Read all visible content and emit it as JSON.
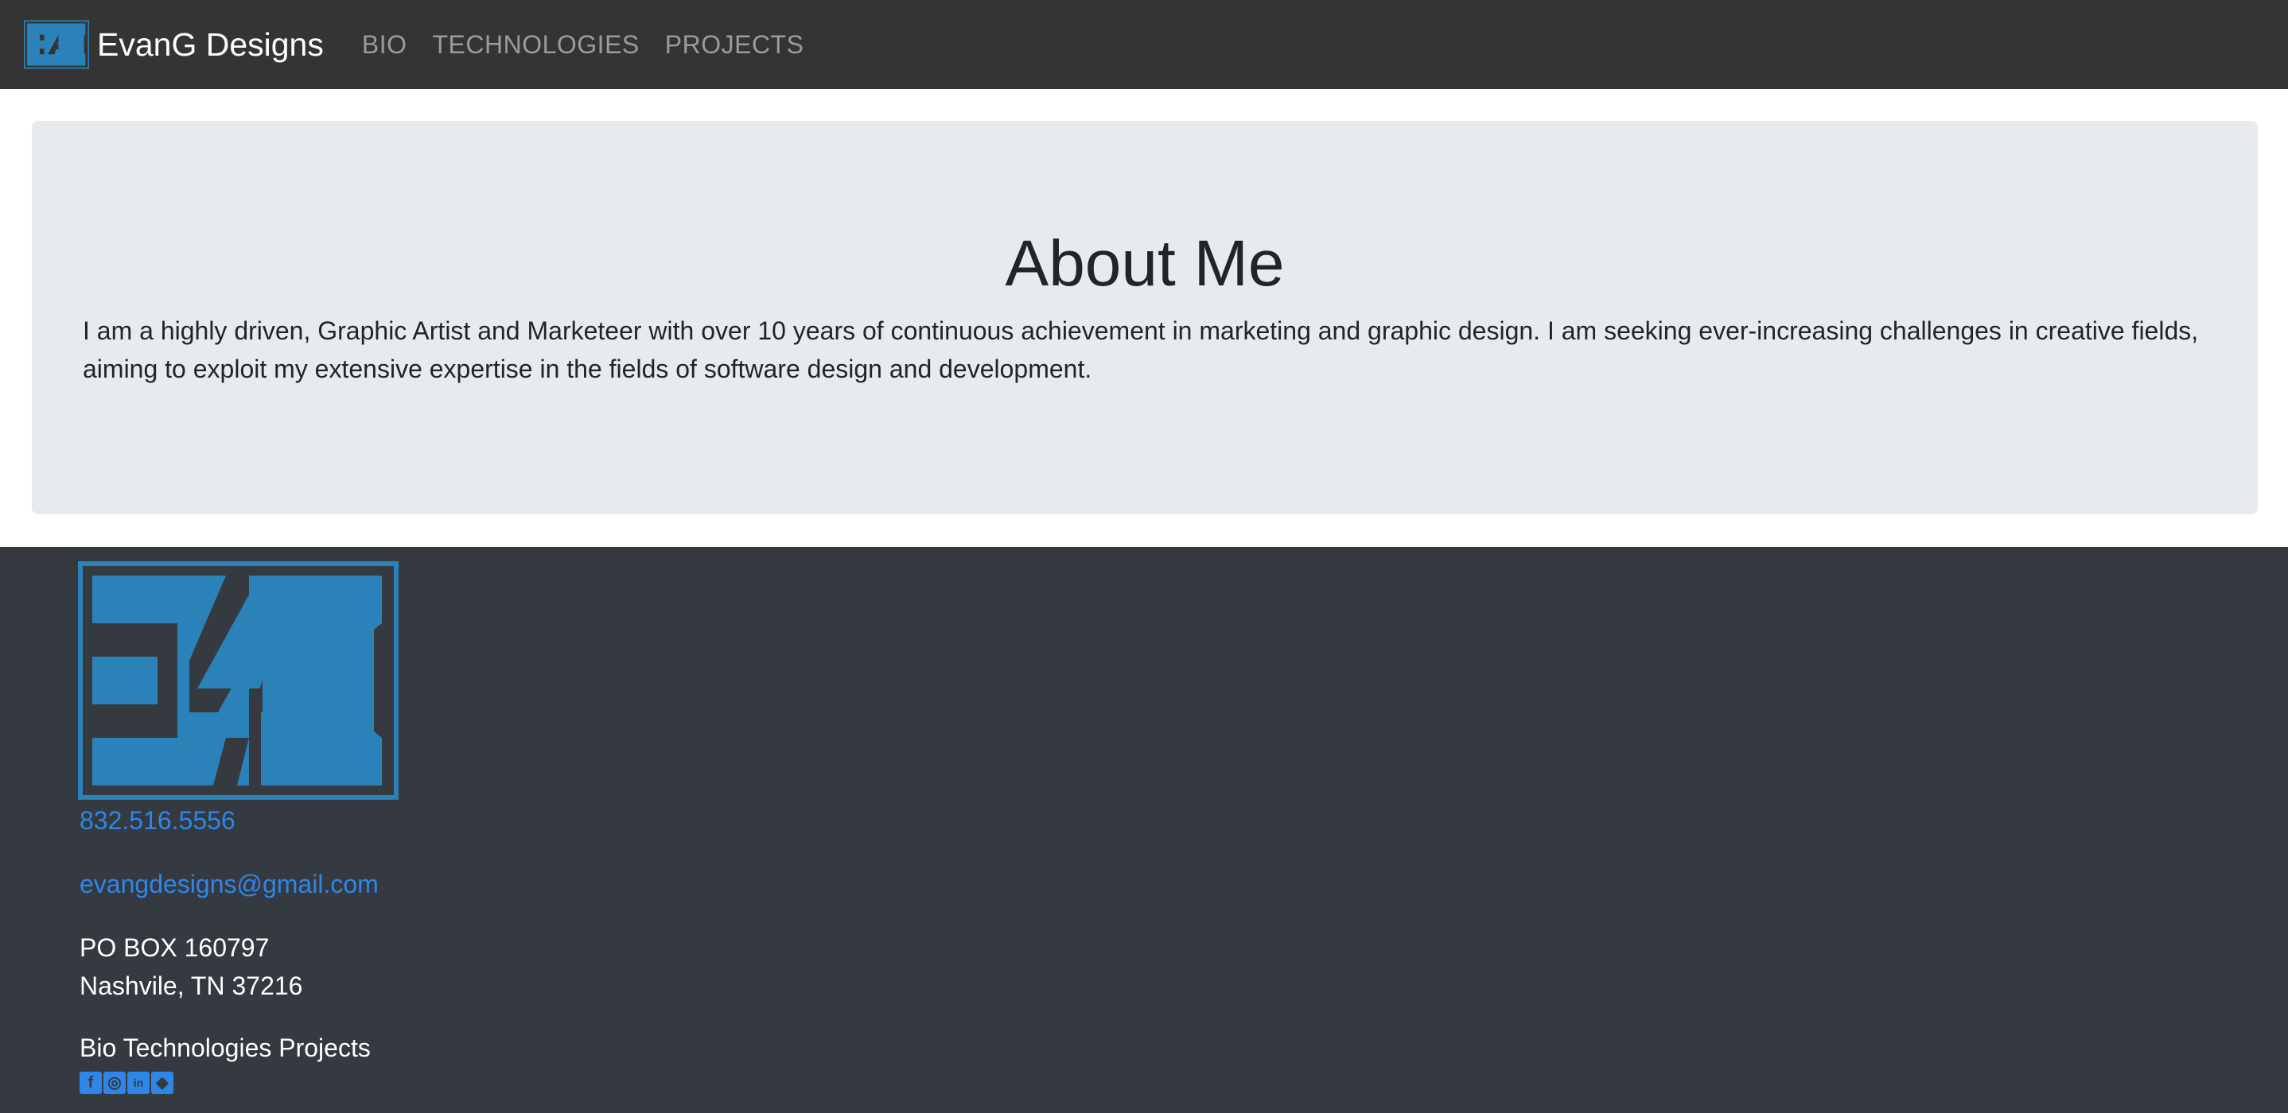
{
  "navbar": {
    "brand": "EvanG Designs",
    "links": [
      "BIO",
      "TECHNOLOGIES",
      "PROJECTS"
    ]
  },
  "jumbotron": {
    "title": "About Me",
    "text": "I am a highly driven, Graphic Artist and Marketeer with over 10 years of continuous achievement in marketing and graphic design. I am seeking ever-increasing challenges in creative fields, aiming to exploit my extensive expertise in the fields of software design and development."
  },
  "footer": {
    "phone": "832.516.5556",
    "email": "evangdesigns@gmail.com",
    "address_line1": "PO BOX 160797",
    "address_line2": "Nashvile, TN 37216",
    "nav": [
      "Bio",
      "Technologies",
      "Projects"
    ],
    "social": [
      {
        "name": "facebook-icon",
        "glyph": "f"
      },
      {
        "name": "instagram-icon",
        "glyph": "◎"
      },
      {
        "name": "linkedin-icon",
        "glyph": "in"
      },
      {
        "name": "github-icon",
        "glyph": "◆"
      }
    ]
  },
  "colors": {
    "navbar_bg": "#343434",
    "jumbotron_bg": "#e8ebee",
    "footer_bg": "#343a40",
    "accent": "#2f86e9",
    "logo_blue": "#2b82b8"
  }
}
